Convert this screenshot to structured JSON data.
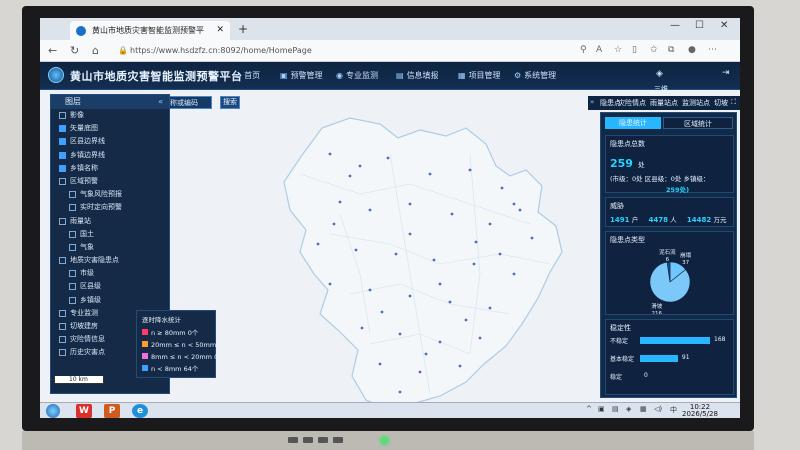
{
  "browser": {
    "tab_title": "黄山市地质灾害智能监测预警平",
    "url": "https://www.hsdzfz.cn:8092/home/HomePage"
  },
  "app": {
    "title": "黄山市地质灾害智能监测预警平台",
    "nav": [
      "首页",
      "预警管理",
      "专业监测",
      "信息填报",
      "项目管理",
      "系统管理"
    ]
  },
  "left_panel": {
    "header": "图层",
    "items": [
      {
        "label": "影像",
        "checked": false,
        "level": 1
      },
      {
        "label": "矢量底图",
        "checked": true,
        "level": 1
      },
      {
        "label": "区县边界线",
        "checked": true,
        "level": 1
      },
      {
        "label": "乡镇边界线",
        "checked": true,
        "level": 1
      },
      {
        "label": "乡镇名称",
        "checked": true,
        "level": 1
      },
      {
        "label": "区域预警",
        "checked": false,
        "level": 1
      },
      {
        "label": "气象风险预报",
        "checked": false,
        "level": 2
      },
      {
        "label": "实时定向预警",
        "checked": false,
        "level": 2
      },
      {
        "label": "雨量站",
        "checked": false,
        "level": 1
      },
      {
        "label": "国土",
        "checked": false,
        "level": 2
      },
      {
        "label": "气象",
        "checked": false,
        "level": 2
      },
      {
        "label": "地质灾害隐患点",
        "checked": false,
        "level": 1
      },
      {
        "label": "市级",
        "checked": false,
        "level": 2
      },
      {
        "label": "区县级",
        "checked": false,
        "level": 2
      },
      {
        "label": "乡镇级",
        "checked": false,
        "level": 2
      },
      {
        "label": "专业监测",
        "checked": false,
        "level": 1
      },
      {
        "label": "切坡建房",
        "checked": false,
        "level": 1
      },
      {
        "label": "灾险情信息",
        "checked": false,
        "level": 1
      },
      {
        "label": "历史灾害点",
        "checked": false,
        "level": 1
      }
    ]
  },
  "search": {
    "placeholder": "请输入名称或编码",
    "button": "搜索"
  },
  "legend": {
    "title": "逐时降水统计",
    "items": [
      {
        "label": "n ≥ 80mm 0个",
        "color": "#ff3b6b"
      },
      {
        "label": "20mm ≤ n < 50mm 0个",
        "color": "#ff9a2e"
      },
      {
        "label": "8mm ≤ n < 20mm 0个",
        "color": "#f070e0"
      },
      {
        "label": "n < 8mm 64个",
        "color": "#3ea0ff"
      }
    ]
  },
  "scale": "10 km",
  "right_tabs": [
    "隐患点",
    "灾险情点",
    "雨量站点",
    "监测站点",
    "切坡"
  ],
  "right_panel": {
    "view3d": "三维",
    "seg_a": "隐患统计",
    "seg_b": "区域统计",
    "total_title": "隐患点总数",
    "total_value": "259",
    "total_unit": "处",
    "breakdown_1": "(市级：0处 区县级：0处 乡镇级：",
    "breakdown_2": "259处)",
    "threat_title": "威胁",
    "households": "1491",
    "households_unit": "户",
    "people": "4478",
    "people_unit": "人",
    "money": "14482",
    "money_unit": "万元",
    "type_title": "隐患点类型",
    "pie": [
      {
        "label": "崩塌",
        "value": 37,
        "color": "#6ec8ff"
      },
      {
        "label": "滑坡",
        "value": 216,
        "color": "#7cc8f8"
      },
      {
        "label": "泥石流",
        "value": 6,
        "color": "#1a4f86"
      }
    ],
    "stability_title": "稳定性",
    "stability": [
      {
        "label": "不稳定",
        "value": 168
      },
      {
        "label": "基本稳定",
        "value": 91
      },
      {
        "label": "稳定",
        "value": 0
      }
    ]
  },
  "taskbar": {
    "time": "10:22",
    "date": "2026/5/28"
  }
}
